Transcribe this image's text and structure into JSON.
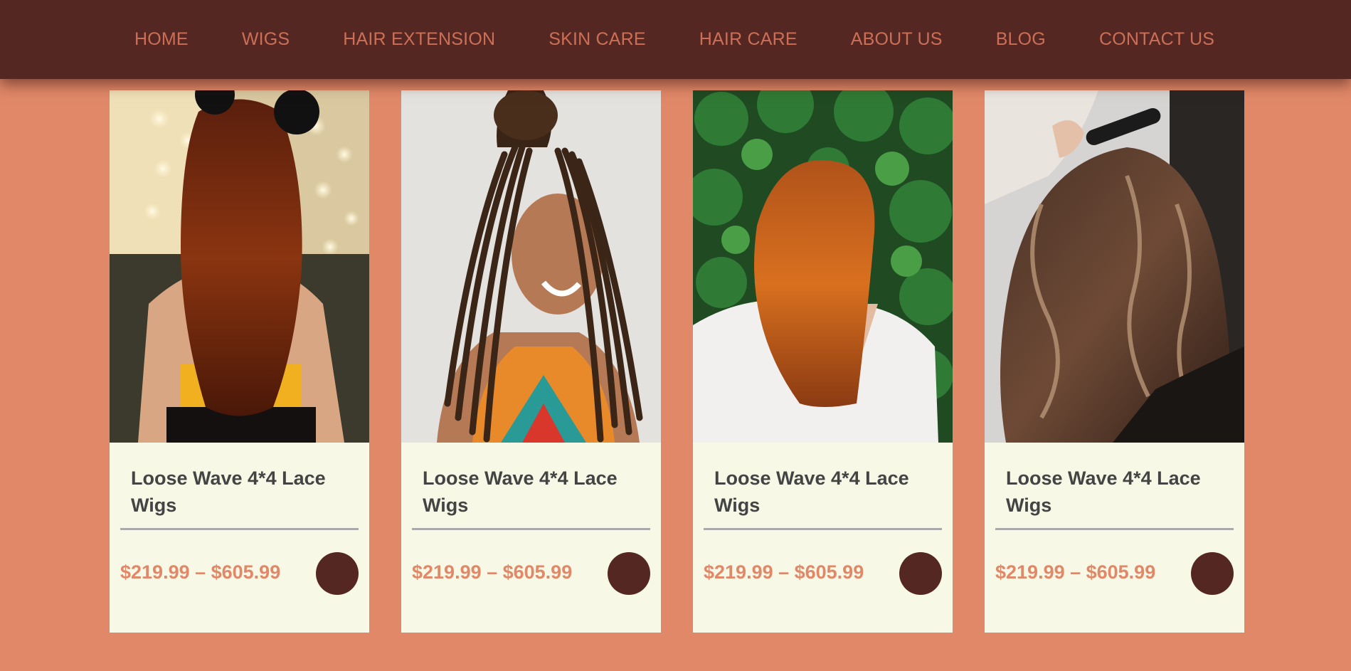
{
  "nav": {
    "items": [
      {
        "label": "HOME"
      },
      {
        "label": "WIGS"
      },
      {
        "label": "HAIR EXTENSION"
      },
      {
        "label": "SKIN CARE"
      },
      {
        "label": "HAIR CARE"
      },
      {
        "label": "ABOUT US"
      },
      {
        "label": "BLOG"
      },
      {
        "label": "CONTACT US"
      }
    ]
  },
  "products": [
    {
      "title": "Loose Wave 4*4 Lace Wigs",
      "price": "$219.99 – $605.99",
      "image": "photo-long-auburn-hair-back-view"
    },
    {
      "title": "Loose Wave 4*4 Lace Wigs",
      "price": "$219.99 – $605.99",
      "image": "photo-smiling-woman-box-braids"
    },
    {
      "title": "Loose Wave 4*4 Lace Wigs",
      "price": "$219.99 – $605.99",
      "image": "photo-copper-hair-green-leaves"
    },
    {
      "title": "Loose Wave 4*4 Lace Wigs",
      "price": "$219.99 – $605.99",
      "image": "photo-brown-curls-being-styled"
    }
  ],
  "colors": {
    "nav_bg": "#552722",
    "nav_text": "#cc6f57",
    "page_bg": "#e08868",
    "card_bg": "#f8f8e6",
    "price": "#e08868",
    "button": "#552722"
  }
}
